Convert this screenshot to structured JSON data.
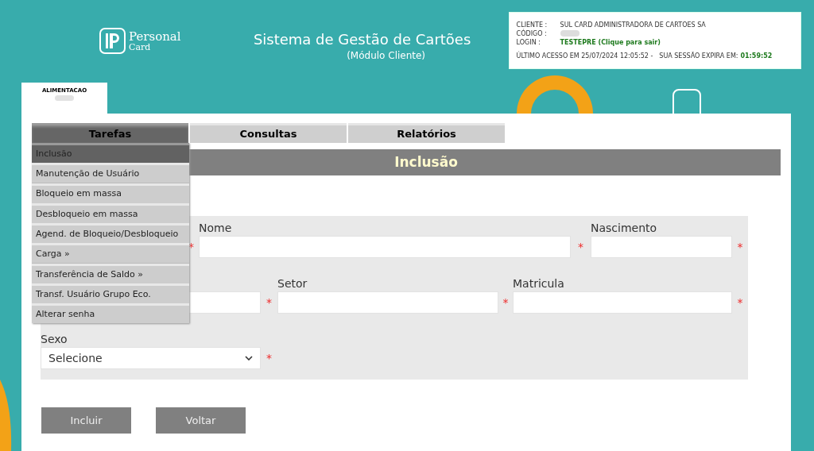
{
  "header": {
    "logo": {
      "name": "Personal",
      "sub": "Card"
    },
    "title": "Sistema de Gestão de Cartões",
    "subtitle": "(Módulo Cliente)"
  },
  "session": {
    "rows": [
      {
        "label": "CLIENTE :",
        "value": "SUL CARD ADMINISTRADORA DE CARTOES SA",
        "kind": "text"
      },
      {
        "label": "CÓDIGO :",
        "kind": "blurred"
      },
      {
        "label": "LOGIN :",
        "value": "TESTEPRE (Clique para sair)",
        "kind": "link"
      }
    ],
    "last_access": "ÚLTIMO ACESSO EM 25/07/2024 12:05:52 -",
    "expires_label": "SUA SESSÃO EXPIRA EM:",
    "expires_value": "01:59:52"
  },
  "product_tab": {
    "label": "ALIMENTACAO"
  },
  "tabs": [
    {
      "label": "Tarefas",
      "selected": true
    },
    {
      "label": "Consultas",
      "selected": false
    },
    {
      "label": "Relatórios",
      "selected": false
    }
  ],
  "menu": [
    {
      "label": "Inclusão",
      "selected": true
    },
    {
      "label": "Manutenção de Usuário",
      "selected": false
    },
    {
      "label": "Bloqueio em massa",
      "selected": false
    },
    {
      "label": "Desbloqueio em massa",
      "selected": false
    },
    {
      "label": "Agend. de Bloqueio/Desbloqueio",
      "selected": false
    },
    {
      "label": "Carga »",
      "selected": false
    },
    {
      "label": "Transferência de Saldo »",
      "selected": false
    },
    {
      "label": "Transf. Usuário Grupo Eco.",
      "selected": false
    },
    {
      "label": "Alterar senha",
      "selected": false
    }
  ],
  "page_title": "Inclusão",
  "form": {
    "rows": [
      [
        {
          "kind": "covered",
          "mark": "*"
        },
        {
          "kind": "text",
          "label": "Nome",
          "mark": "*"
        },
        {
          "kind": "text",
          "label": "Nascimento",
          "mark": "*"
        }
      ],
      [
        {
          "kind": "text",
          "mark": "*"
        },
        {
          "kind": "text",
          "label": "Setor",
          "mark": "*"
        },
        {
          "kind": "text",
          "label": "Matricula",
          "mark": "*"
        }
      ],
      [
        {
          "kind": "select",
          "label": "Sexo",
          "value": "Selecione",
          "mark": "*"
        }
      ]
    ]
  },
  "buttons": [
    "Incluir",
    "Voltar"
  ]
}
